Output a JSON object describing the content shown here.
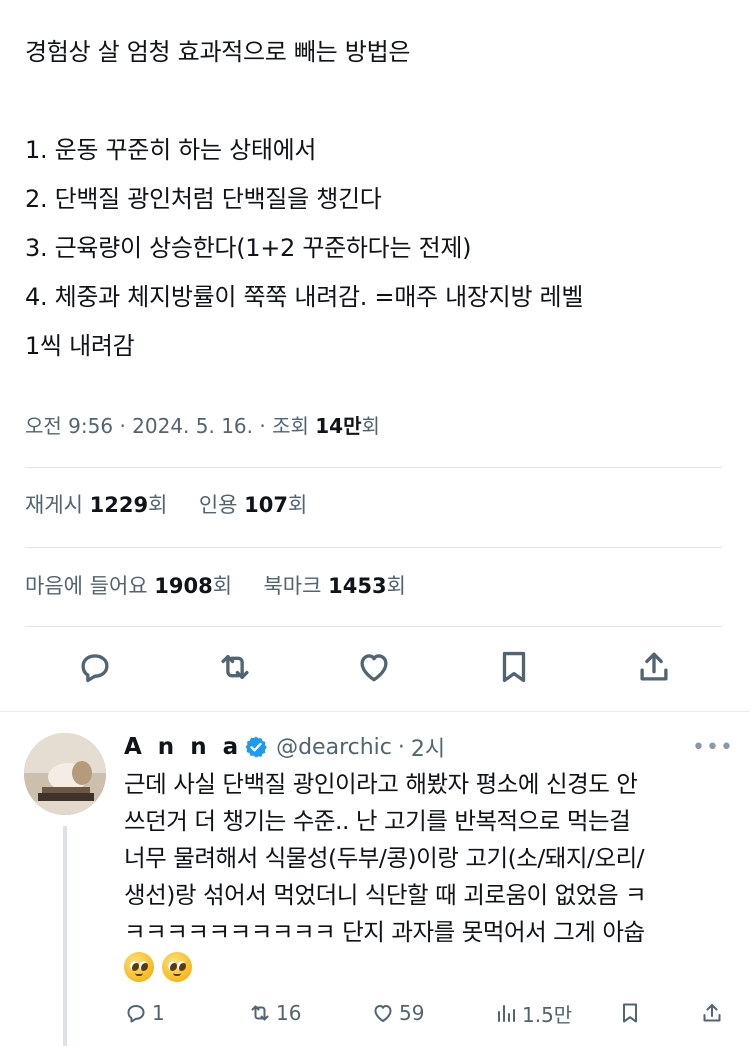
{
  "post": {
    "lines": [
      "경험상 살 엄청 효과적으로 빼는 방법은",
      "",
      "1. 운동 꾸준히 하는 상태에서",
      "2. 단백질 광인처럼 단백질을 챙긴다",
      "3. 근육량이 상승한다(1+2 꾸준하다는 전제)",
      "4. 체중과 체지방률이 쭉쭉 내려감. =매주 내장지방 레벨",
      "1씩 내려감"
    ],
    "meta": {
      "time": "오전 9:56",
      "date": "2024. 5. 16.",
      "views_label": "조회",
      "views_value": "14만",
      "views_unit": "회"
    },
    "stats": {
      "reposts_label": "재게시",
      "reposts_value": "1229",
      "reposts_unit": "회",
      "quotes_label": "인용",
      "quotes_value": "107",
      "quotes_unit": "회",
      "likes_label": "마음에 들어요",
      "likes_value": "1908",
      "likes_unit": "회",
      "bookmarks_label": "북마크",
      "bookmarks_value": "1453",
      "bookmarks_unit": "회"
    }
  },
  "reply": {
    "name": "A n n a",
    "handle": "@dearchic",
    "dot": "·",
    "time": "2시",
    "more": "•••",
    "lines": [
      "근데 사실 단백질 광인이라고 해봤자 평소에 신경도 안",
      "쓰던거 더 챙기는 수준.. 난 고기를 반복적으로 먹는걸",
      "너무 물려해서 식물성(두부/콩)이랑 고기(소/돼지/오리/",
      "생선)랑 섞어서 먹었더니 식단할 때 괴로움이 없었음 ㅋ",
      "ㅋㅋㅋㅋㅋㅋㅋㅋㅋㅋ 단지 과자를 못먹어서 그게 아숩"
    ],
    "emoji_name": "pleading-face",
    "actions": {
      "replies": "1",
      "reposts": "16",
      "likes": "59",
      "views": "1.5만"
    }
  },
  "colors": {
    "text": "#0f1419",
    "secondary": "#536471",
    "verified": "#1d9bf0",
    "divider": "#e1e6ea"
  }
}
